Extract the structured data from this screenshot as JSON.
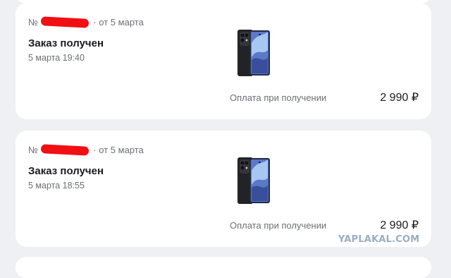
{
  "orders": [
    {
      "number_prefix": "№",
      "separator": "·",
      "date_label": "от 5 марта",
      "status": "Заказ получен",
      "datetime": "5 марта 19:40",
      "product_image": "smartphone-image",
      "payment": "Оплата при получении",
      "price": "2 990 ₽"
    },
    {
      "number_prefix": "№",
      "separator": "·",
      "date_label": "от 5 марта",
      "status": "Заказ получен",
      "datetime": "5 марта 18:55",
      "product_image": "smartphone-image",
      "payment": "Оплата при получении",
      "price": "2 990 ₽"
    }
  ],
  "colors": {
    "background": "#eef0f3",
    "card": "#ffffff",
    "redaction": "#f10f14",
    "muted_text": "#6b6f76",
    "primary_text": "#1b1b1f"
  },
  "watermark": "YAPLAKAL.COM"
}
